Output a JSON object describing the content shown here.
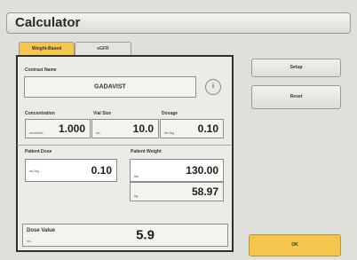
{
  "window": {
    "title": "Calculator"
  },
  "tabs": [
    {
      "label": "Weight-Based",
      "active": true
    },
    {
      "label": "eGFR",
      "active": false
    }
  ],
  "contrast": {
    "label": "Contrast Name",
    "value": "GADAVIST",
    "info_icon": "info-icon"
  },
  "concentration": {
    "label": "Concentration",
    "unit": "mmol/mL",
    "value": "1.000"
  },
  "vial_size": {
    "label": "Vial Size",
    "unit": "mL",
    "value": "10.0"
  },
  "dosage": {
    "label": "Dosage",
    "unit": "mL/kg",
    "value": "0.10"
  },
  "patient_dose": {
    "label": "Patient Dose",
    "unit": "mL/kg",
    "value": "0.10"
  },
  "patient_weight": {
    "label": "Patient Weight",
    "lbs_unit": "lbs",
    "lbs_value": "130.00",
    "kg_unit": "kg",
    "kg_value": "58.97"
  },
  "dose_value": {
    "label": "Dose Value",
    "unit": "mL",
    "value": "5.9"
  },
  "side": {
    "setup_label": "Setup",
    "reset_label": "Reset",
    "ok_label": "OK"
  },
  "colors": {
    "accent": "#f5c64e",
    "panel_border": "#2f2f2f",
    "background": "#dfe0da"
  }
}
